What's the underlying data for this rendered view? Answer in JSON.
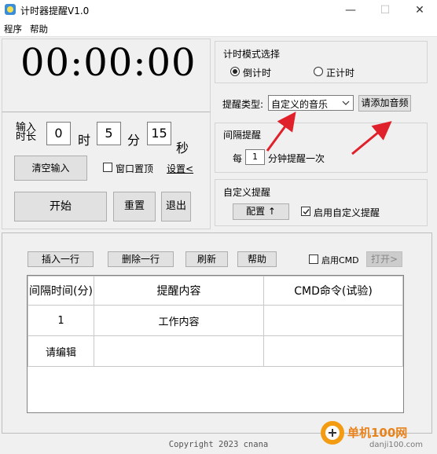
{
  "window": {
    "title": "计时器提醒V1.0",
    "minimize": "—",
    "maximize": "☐",
    "close": "✕"
  },
  "menu": [
    {
      "label": "程序"
    },
    {
      "label": "帮助"
    }
  ],
  "timer": {
    "display": "00:00:00"
  },
  "input": {
    "label_line1": "输入",
    "label_line2": "时长",
    "hours": "0",
    "hours_unit": "时",
    "minutes": "5",
    "minutes_unit": "分",
    "seconds": "15",
    "seconds_unit": "秒"
  },
  "buttons": {
    "clear": "清空输入",
    "window_top": "窗口置顶",
    "settings": "设置<",
    "start": "开始",
    "reset": "重置",
    "exit": "退出"
  },
  "mode": {
    "title": "计时模式选择",
    "countdown": "倒计时",
    "countup": "正计时",
    "selected": "countdown"
  },
  "remind_type": {
    "label": "提醒类型:",
    "selected": "自定义的音乐",
    "add_audio": "请添加音频"
  },
  "interval": {
    "title": "间隔提醒",
    "every": "每",
    "value": "1",
    "suffix": "分钟提醒一次"
  },
  "custom": {
    "title": "自定义提醒",
    "config": "配置 ↑",
    "enable_label": "启用自定义提醒",
    "enabled": true
  },
  "toolbar": {
    "insert": "插入一行",
    "delete": "删除一行",
    "refresh": "刷新",
    "help": "帮助",
    "enable_cmd": "启用CMD",
    "open": "打开>"
  },
  "table": {
    "headers": [
      "间隔时间(分)",
      "提醒内容",
      "CMD命令(试验)"
    ],
    "rows": [
      [
        "1",
        "工作内容",
        ""
      ],
      [
        "请编辑",
        "",
        ""
      ]
    ]
  },
  "footer": "Copyright 2023 cnana",
  "watermark": {
    "cn": "单机100网",
    "url": "danji100.com"
  },
  "colors": {
    "arrow": "#e0202a",
    "accent": "#3c8dd9"
  }
}
